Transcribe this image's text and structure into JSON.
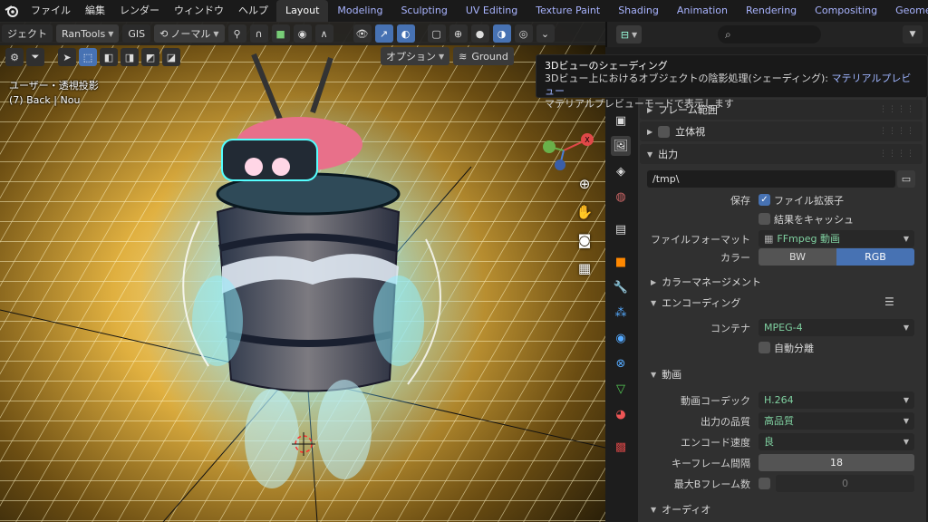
{
  "app": {
    "logo_icon": "blender-logo-icon",
    "menu": [
      "ファイル",
      "編集",
      "レンダー",
      "ウィンドウ",
      "ヘルプ"
    ]
  },
  "workspaces": {
    "tabs": [
      "Layout",
      "Modeling",
      "Sculpting",
      "UV Editing",
      "Texture Paint",
      "Shading",
      "Animation",
      "Rendering",
      "Compositing",
      "Geometry No"
    ],
    "active": "Layout"
  },
  "viewport_header": {
    "object_menu": "ジェクト",
    "addon1": "RanTools",
    "addon2": "GIS",
    "transform_orientation": "ノーマル",
    "options_label": "オプション",
    "ground_label": "Ground"
  },
  "viewport_overlay": {
    "view_name": "ユーザー・透視投影",
    "collection_info": "(7) Back | Nou"
  },
  "tooltip": {
    "title": "3Dビューのシェーディング",
    "description_prefix": "3Dビュー上におけるオブジェクトの陰影処理(シェーディング): ",
    "description_value": "マテリアルプレビュー",
    "detail": "マテリアルプレビューモードで表示します"
  },
  "properties": {
    "search_icon": "search-icon",
    "panels": {
      "frame_range": "フレーム範囲",
      "stereoscopy": "立体視",
      "output": "出力"
    },
    "output": {
      "path": "/tmp\\",
      "save_label": "保存",
      "file_extension_label": "ファイル拡張子",
      "file_extension_checked": true,
      "cache_result_label": "結果をキャッシュ",
      "cache_result_checked": false,
      "file_format_label": "ファイルフォーマット",
      "file_format_value": "FFmpeg 動画",
      "color_label": "カラー",
      "color_options": [
        "BW",
        "RGB"
      ],
      "color_selected": "RGB",
      "color_management": "カラーマネージメント"
    },
    "encoding": {
      "title": "エンコーディング",
      "container_label": "コンテナ",
      "container_value": "MPEG-4",
      "autosplit_label": "自動分離",
      "autosplit_checked": false
    },
    "video": {
      "title": "動画",
      "codec_label": "動画コーデック",
      "codec_value": "H.264",
      "quality_label": "出力の品質",
      "quality_value": "高品質",
      "speed_label": "エンコード速度",
      "speed_value": "良",
      "keyframe_label": "キーフレーム間隔",
      "keyframe_value": "18",
      "max_bframes_label": "最大Bフレーム数",
      "max_bframes_value": "0",
      "max_bframes_checked": false
    },
    "audio": {
      "title": "オーディオ"
    }
  }
}
